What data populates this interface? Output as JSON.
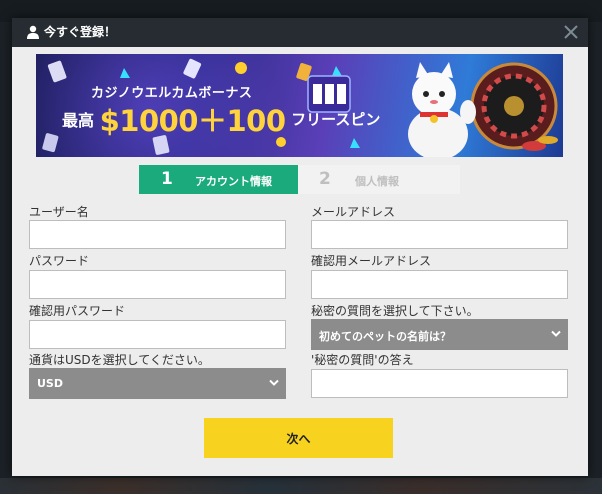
{
  "modal": {
    "title": "今すぐ登録！"
  },
  "banner": {
    "line1": "カジノウエルカムボーナス",
    "line2_prefix": "最高",
    "line2_amount": "$1000＋100",
    "line2_suffix": "フリースピン"
  },
  "steps": [
    {
      "number": "1",
      "label": "アカウント情報",
      "active": true
    },
    {
      "number": "2",
      "label": "個人情報",
      "active": false
    }
  ],
  "form": {
    "username_label": "ユーザー名",
    "username_value": "",
    "password_label": "パスワード",
    "password_value": "",
    "confirm_password_label": "確認用パスワード",
    "confirm_password_value": "",
    "currency_label": "通貨はUSDを選択してください。",
    "currency_value": "USD",
    "email_label": "メールアドレス",
    "email_value": "",
    "confirm_email_label": "確認用メールアドレス",
    "confirm_email_value": "",
    "secret_question_label": "秘密の質問を選択して下さい。",
    "secret_question_value": "初めてのペットの名前は？",
    "secret_answer_label": "'秘密の質問'の答え",
    "secret_answer_value": ""
  },
  "next_button": "次へ",
  "colors": {
    "header_bg": "#262c31",
    "step_active": "#1aaa7c",
    "next_button": "#f7d21f",
    "select_bg": "#8c8c8c"
  },
  "icons": [
    "user-icon",
    "close-icon",
    "chevron-down-icon"
  ]
}
